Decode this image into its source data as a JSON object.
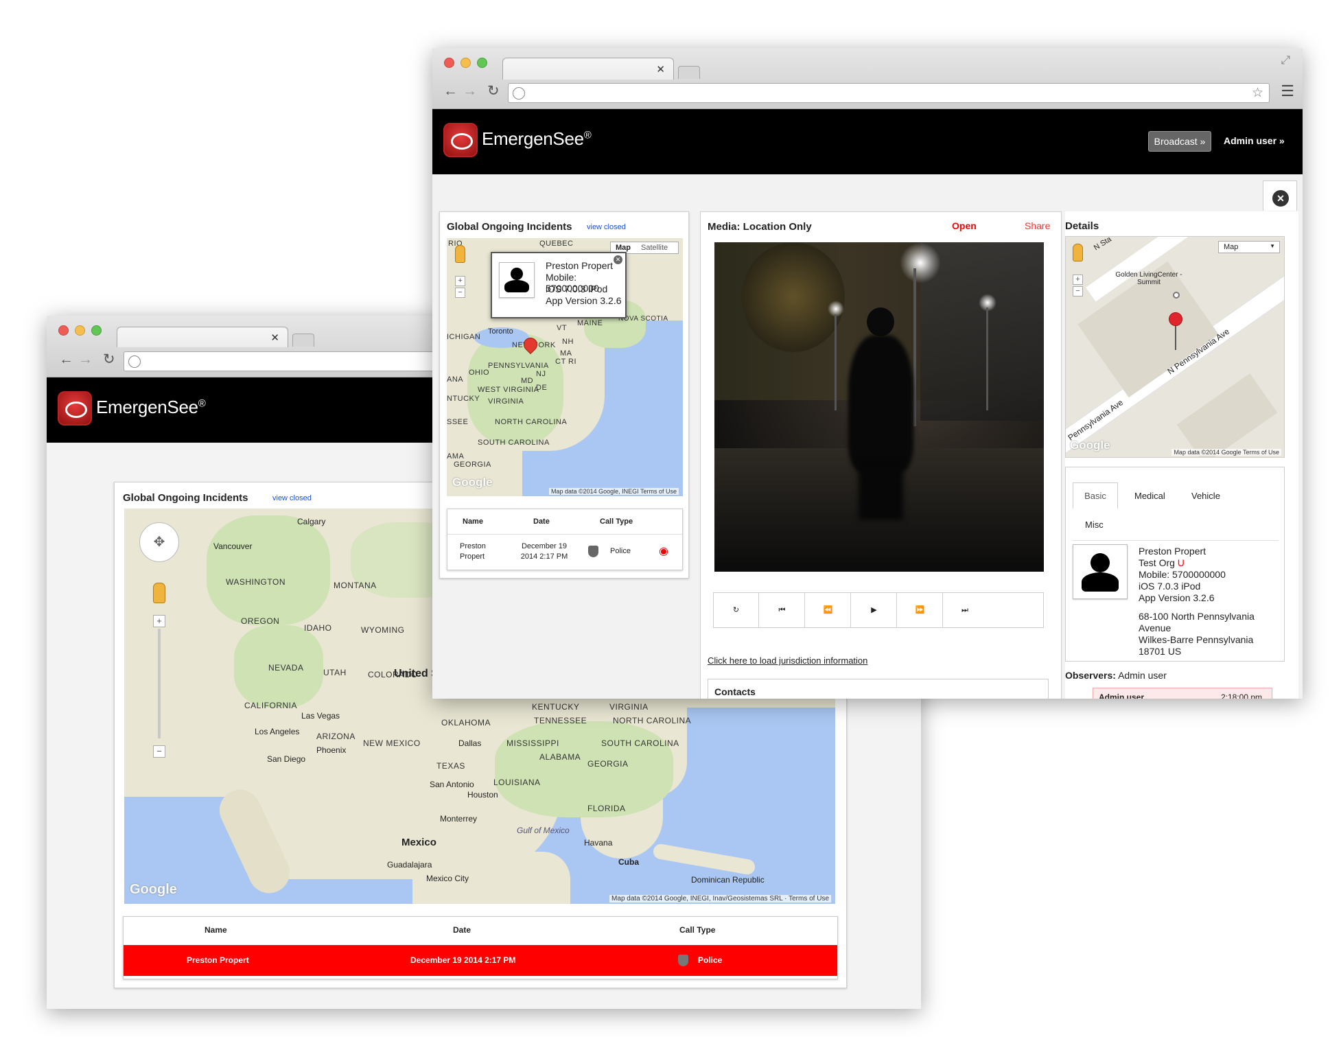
{
  "app": {
    "brand": "EmergenSee",
    "reg": "®",
    "broadcast_label": "Broadcast »",
    "user_label": "Admin user »"
  },
  "back_window": {
    "panel_title": "Global Ongoing Incidents",
    "view_closed": "view closed",
    "map": {
      "labels": [
        "Calgary",
        "Vancouver",
        "WASHINGTON",
        "MONTANA",
        "OREGON",
        "IDAHO",
        "WYOMING",
        "NEVADA",
        "UTAH",
        "COLORADO",
        "CALIFORNIA",
        "Las Vegas",
        "Los Angeles",
        "San Diego",
        "ARIZONA",
        "Phoenix",
        "NEW MEXICO",
        "United S",
        "TEXAS",
        "Dallas",
        "OKLAHOMA",
        "San Antonio",
        "Houston",
        "LOUISIANA",
        "MISSISSIPPI",
        "ALABAMA",
        "GEORGIA",
        "TENNESSEE",
        "KENTUCKY",
        "VIRGINIA",
        "NORTH CAROLINA",
        "SOUTH CAROLINA",
        "FLORIDA",
        "Gulf of Mexico",
        "Monterrey",
        "Mexico",
        "Guadalajara",
        "Mexico City",
        "Havana",
        "Cuba",
        "Dominican Republic"
      ],
      "logo": "Google",
      "attribution": "Map data ©2014 Google, INEGI, Inav/Geosistemas SRL · Terms of Use"
    },
    "table": {
      "headers": [
        "Name",
        "Date",
        "Call Type"
      ],
      "row": {
        "name": "Preston Propert",
        "date": "December 19 2014 2:17 PM",
        "type": "Police"
      }
    }
  },
  "front_window": {
    "panel_title": "Global Ongoing Incidents",
    "view_closed": "view closed",
    "map": {
      "map_btn": "Map",
      "satellite_btn": "Satellite",
      "labels": [
        "QUEBEC",
        "RIO",
        "MAINE",
        "NOVA SCOTIA",
        "VT",
        "Toronto",
        "ICHIGAN",
        "NEW YORK",
        "NH",
        "MA",
        "CT RI",
        "PENNSYLVANIA",
        "OHIO",
        "ANA",
        "MD",
        "NJ",
        "DE",
        "WEST VIRGINIA",
        "NTUCKY",
        "VIRGINIA",
        "NORTH CAROLINA",
        "SSEE",
        "SOUTH CAROLINA",
        "AMA",
        "GEORGIA"
      ],
      "logo": "Google",
      "attribution": "Map data ©2014 Google, INEGI  Terms of Use"
    },
    "popup": {
      "name": "Preston Propert",
      "mobile": "Mobile: 5700000000",
      "os": "iOS 7.0.3 iPod",
      "version": "App Version 3.2.6"
    },
    "table": {
      "headers": [
        "Name",
        "Date",
        "Call Type"
      ],
      "row": {
        "name": "Preston Propert",
        "date": "December 19 2014 2:17 PM",
        "type": "Police"
      }
    },
    "media": {
      "title": "Media: Location Only",
      "open": "Open",
      "share": "Share",
      "jurisdiction_link": "Click here to load jurisdiction information",
      "contacts_title": "Contacts"
    },
    "details": {
      "title": "Details",
      "map_select": "Map",
      "map_labels": [
        "N Sta",
        "Golden LivingCenter - Summit",
        "N Pennsylvania Ave",
        "Pennsylvania Ave"
      ],
      "map_attrib": "Map data ©2014 Google   Terms of Use",
      "logo": "Google",
      "tabs": [
        "Basic",
        "Medical",
        "Vehicle",
        "Misc"
      ],
      "name": "Preston Propert",
      "org": "Test Org",
      "org_flag": "U",
      "mobile": "Mobile: 5700000000",
      "os": "iOS 7.0.3 iPod",
      "version": "App Version 3.2.6",
      "address1": "68-100 North Pennsylvania",
      "address2": "Avenue",
      "address3": "Wilkes-Barre Pennsylvania",
      "address4": "18701 US",
      "observers_label": "Observers:",
      "observers_value": "Admin user",
      "log_user": "Admin user",
      "log_time": "2:18:00 pm"
    }
  },
  "colors": {
    "accent_red": "#ff0000",
    "link_blue": "#1a4fd6",
    "appbar": "#000000"
  }
}
